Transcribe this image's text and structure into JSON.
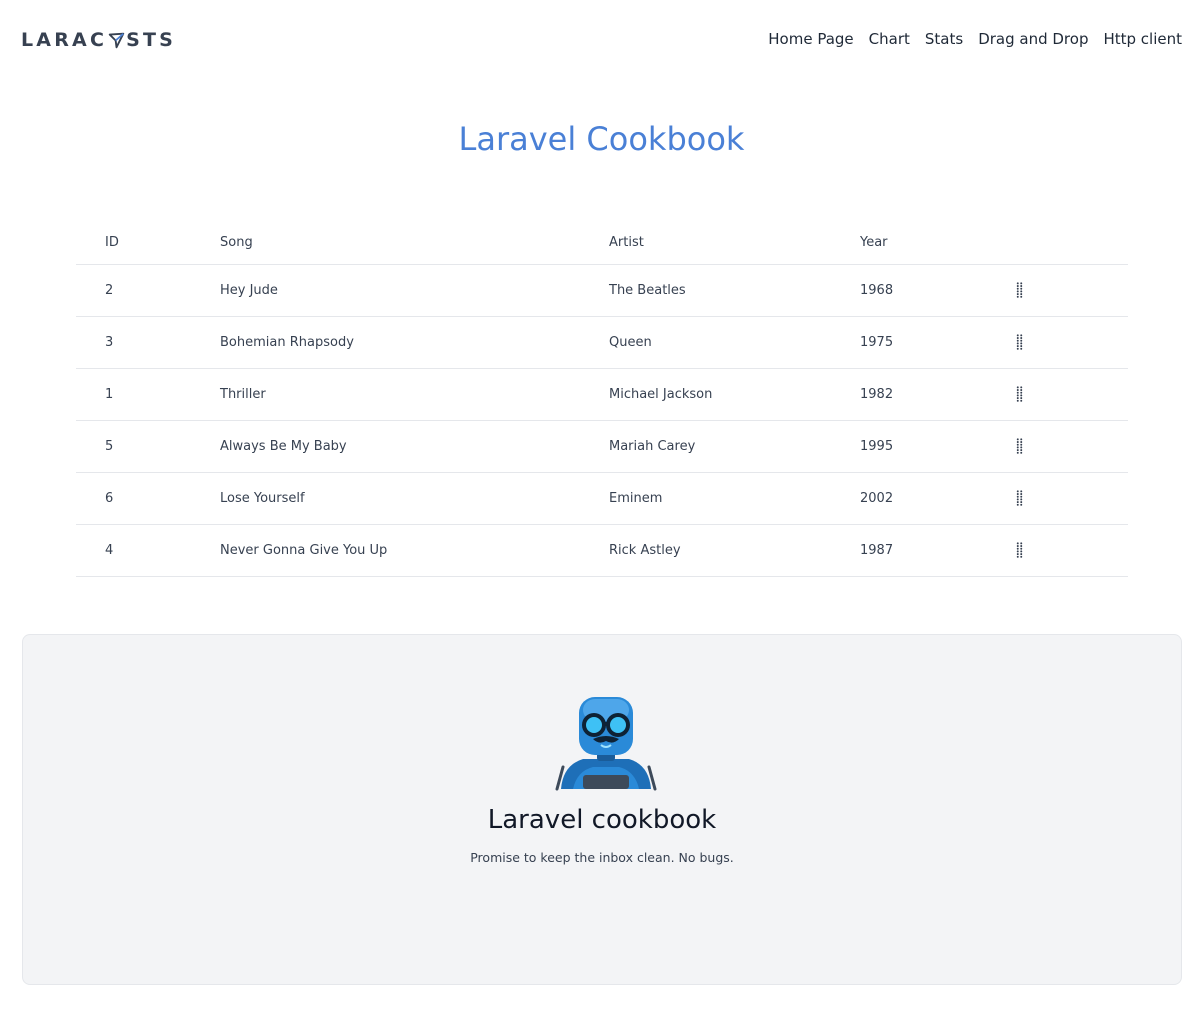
{
  "brand": {
    "logo_text_left": "LARAC",
    "logo_text_right": "STS"
  },
  "nav": {
    "links": [
      {
        "label": "Home Page"
      },
      {
        "label": "Chart"
      },
      {
        "label": "Stats"
      },
      {
        "label": "Drag and Drop"
      },
      {
        "label": "Http client"
      }
    ]
  },
  "page": {
    "title": "Laravel Cookbook"
  },
  "table": {
    "columns": [
      "ID",
      "Song",
      "Artist",
      "Year",
      ""
    ],
    "rows": [
      {
        "id": "2",
        "song": "Hey Jude",
        "artist": "The Beatles",
        "year": "1968"
      },
      {
        "id": "3",
        "song": "Bohemian Rhapsody",
        "artist": "Queen",
        "year": "1975"
      },
      {
        "id": "1",
        "song": "Thriller",
        "artist": "Michael Jackson",
        "year": "1982"
      },
      {
        "id": "5",
        "song": "Always Be My Baby",
        "artist": "Mariah Carey",
        "year": "1995"
      },
      {
        "id": "6",
        "song": "Lose Yourself",
        "artist": "Eminem",
        "year": "2002"
      },
      {
        "id": "4",
        "song": "Never Gonna Give You Up",
        "artist": "Rick Astley",
        "year": "1987"
      }
    ],
    "row_handle_icon": "drag-handle-icon"
  },
  "footer": {
    "mascot_icon": "robot-mascot-icon",
    "title": "Laravel cookbook",
    "subtitle": "Promise to keep the inbox clean. No bugs."
  },
  "colors": {
    "accent": "#4a80d6",
    "footer_bg": "#f3f4f6",
    "text": "#1f2937"
  }
}
